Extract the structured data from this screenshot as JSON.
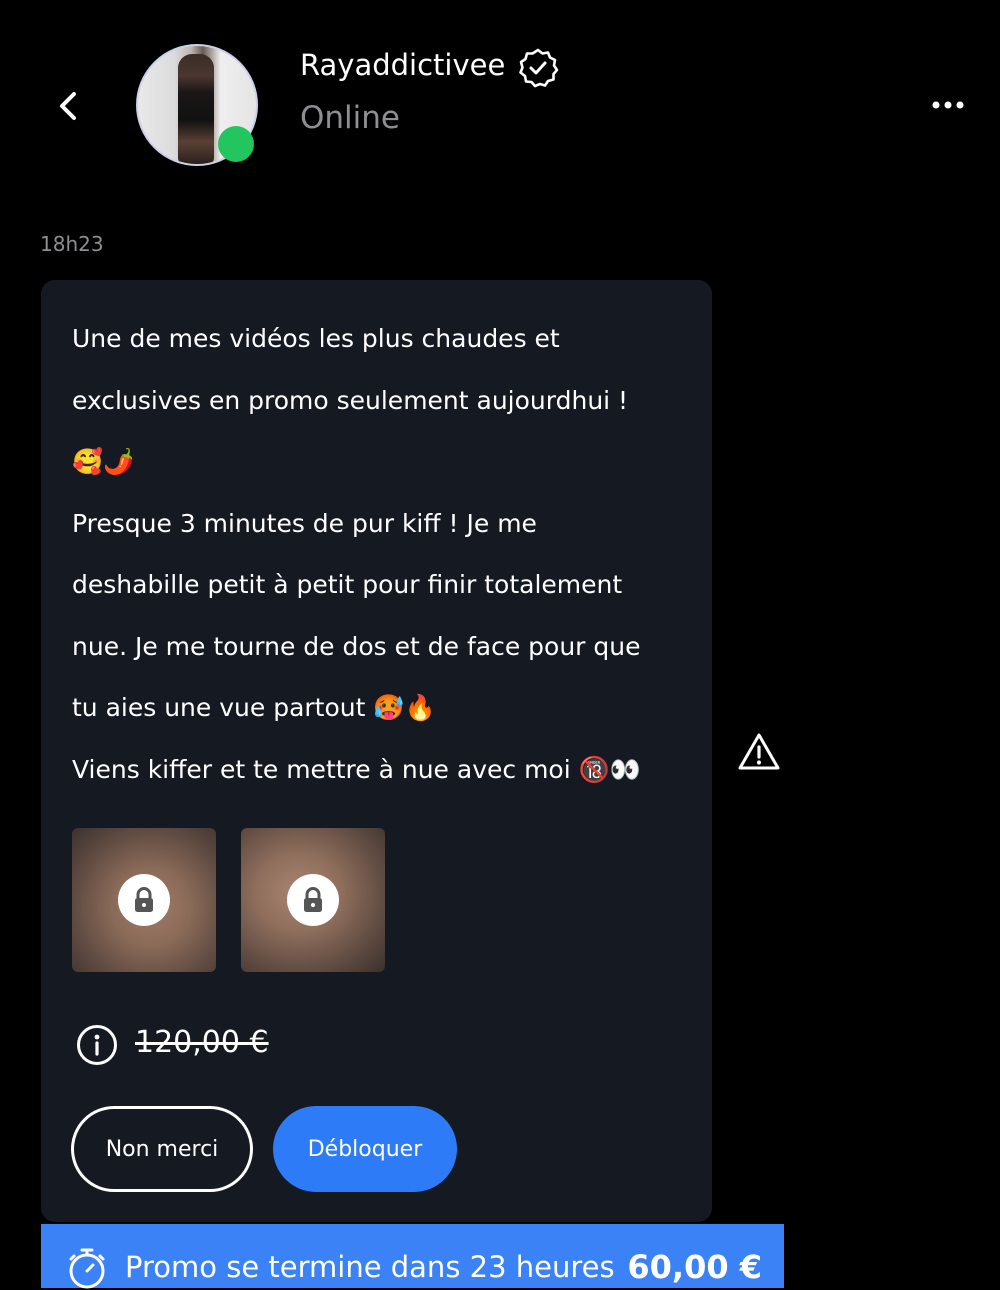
{
  "colors": {
    "background": "#000000",
    "bubble": "#141922",
    "accent": "#2d7bf6",
    "promo": "#3b82f6",
    "online": "#22c55e",
    "muted": "#8e8e93"
  },
  "header": {
    "back_icon": "chevron-left-icon",
    "username": "Rayaddictivee",
    "verified_icon": "verified-badge-icon",
    "status": "Online",
    "more_icon": "more-horizontal-icon"
  },
  "message": {
    "time": "18h23",
    "text": "Une de mes vidéos les plus chaudes et\nexclusives en promo seulement aujourdhui !\n🥰🌶️\nPresque 3 minutes de pur kiff ! Je me\ndeshabille petit à petit pour finir totalement\nnue. Je me tourne de dos et de face pour que\ntu aies une vue partout 🥵🔥\nViens kiffer et te mettre à nue avec moi 🔞👀",
    "media": [
      {
        "icon": "lock-icon"
      },
      {
        "icon": "lock-icon"
      }
    ],
    "original_price": "120,00 €",
    "decline_label": "Non merci",
    "unlock_label": "Débloquer"
  },
  "report_icon": "warning-triangle-icon",
  "promo": {
    "icon": "stopwatch-icon",
    "text": "Promo se termine dans 23 heures",
    "price": "60,00 €"
  }
}
